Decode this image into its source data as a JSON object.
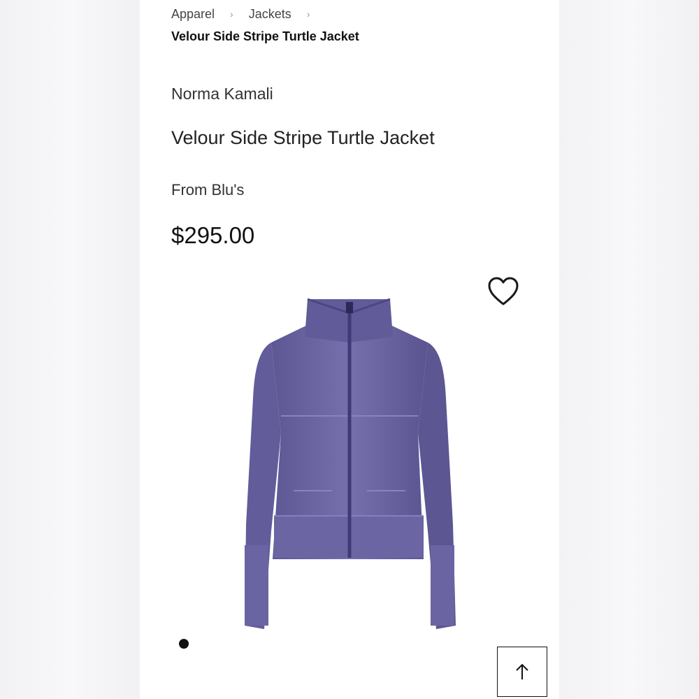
{
  "breadcrumb": {
    "items": [
      "Apparel",
      "Jackets"
    ],
    "current": "Velour Side Stripe Turtle Jacket"
  },
  "product": {
    "brand": "Norma Kamali",
    "name": "Velour Side Stripe Turtle Jacket",
    "seller": "From Blu's",
    "price": "$295.00",
    "color": "#6a64a0"
  },
  "icons": {
    "breadcrumb_separator": "chevron-right-icon",
    "favorite": "heart-outline-icon",
    "back_to_top": "arrow-up-icon"
  },
  "carousel": {
    "active_index": 1,
    "count": 1
  }
}
